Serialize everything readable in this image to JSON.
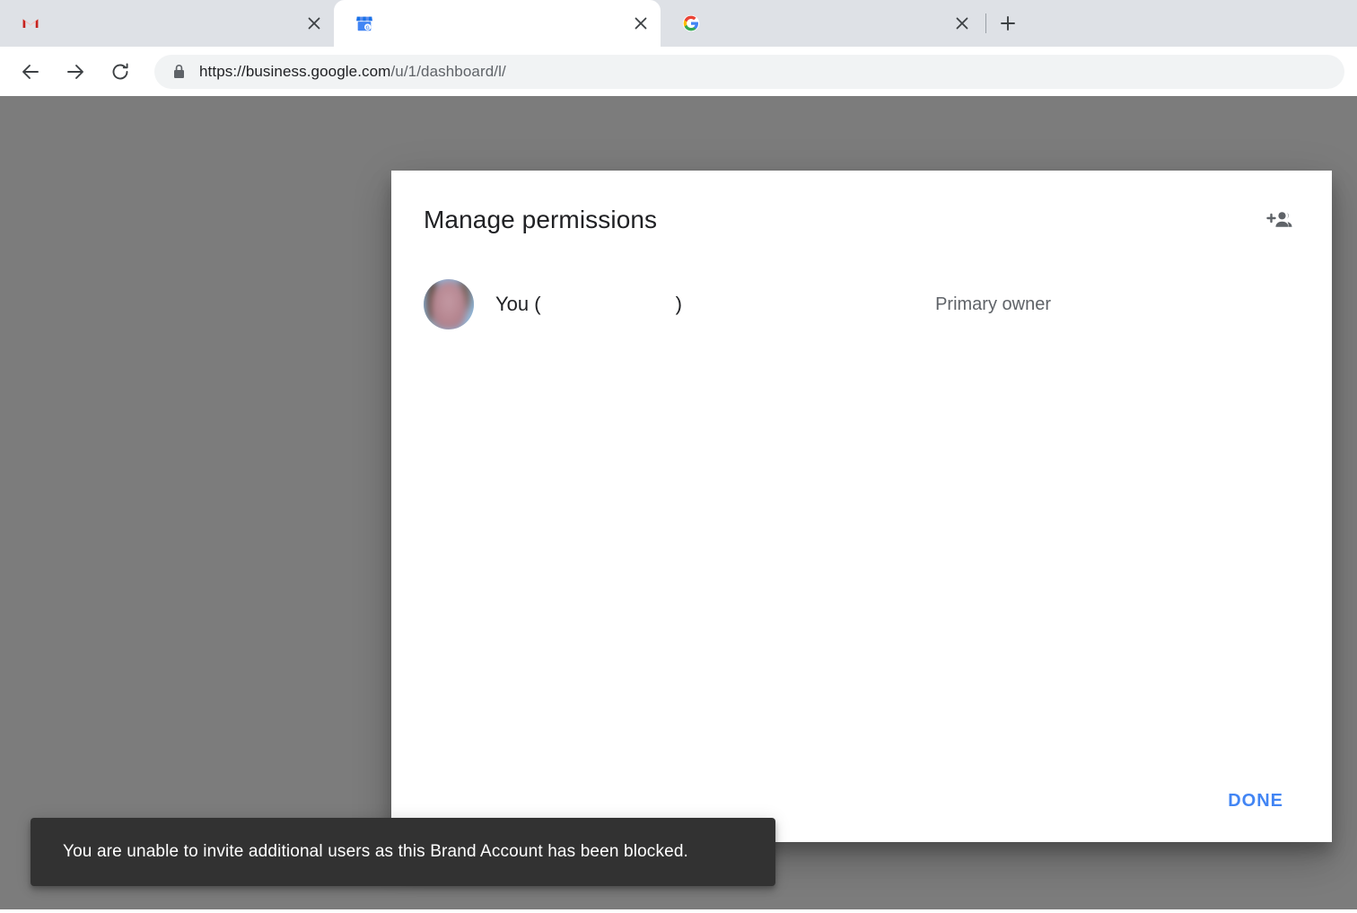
{
  "browser": {
    "tabs": [
      {
        "title": "",
        "favicon": "gmail-icon",
        "active": false,
        "close_label": "×"
      },
      {
        "title": "",
        "favicon": "google-my-business-icon",
        "active": true,
        "close_label": "×"
      },
      {
        "title": "",
        "favicon": "google-g-icon",
        "active": false,
        "close_label": "×"
      }
    ],
    "new_tab_icon": "plus-icon",
    "toolbar": {
      "back_icon": "arrow-back-icon",
      "forward_icon": "arrow-forward-icon",
      "reload_icon": "reload-icon",
      "lock_icon": "lock-icon",
      "url_origin": "https://business.google.com",
      "url_path": "/u/1/dashboard/l/"
    }
  },
  "dialog": {
    "title": "Manage permissions",
    "add_people_icon": "person-add-icon",
    "members": [
      {
        "name": "You (",
        "name_suffix": ")",
        "role": "Primary owner",
        "avatar": "user-avatar"
      }
    ],
    "done_label": "DONE"
  },
  "snackbar": {
    "message": "You are unable to invite additional users as this Brand Account has been blocked."
  },
  "colors": {
    "accent_blue": "#4285f4",
    "scrim_gray": "#7c7c7c",
    "snackbar_bg": "#323232",
    "chrome_bg": "#dee1e6"
  }
}
